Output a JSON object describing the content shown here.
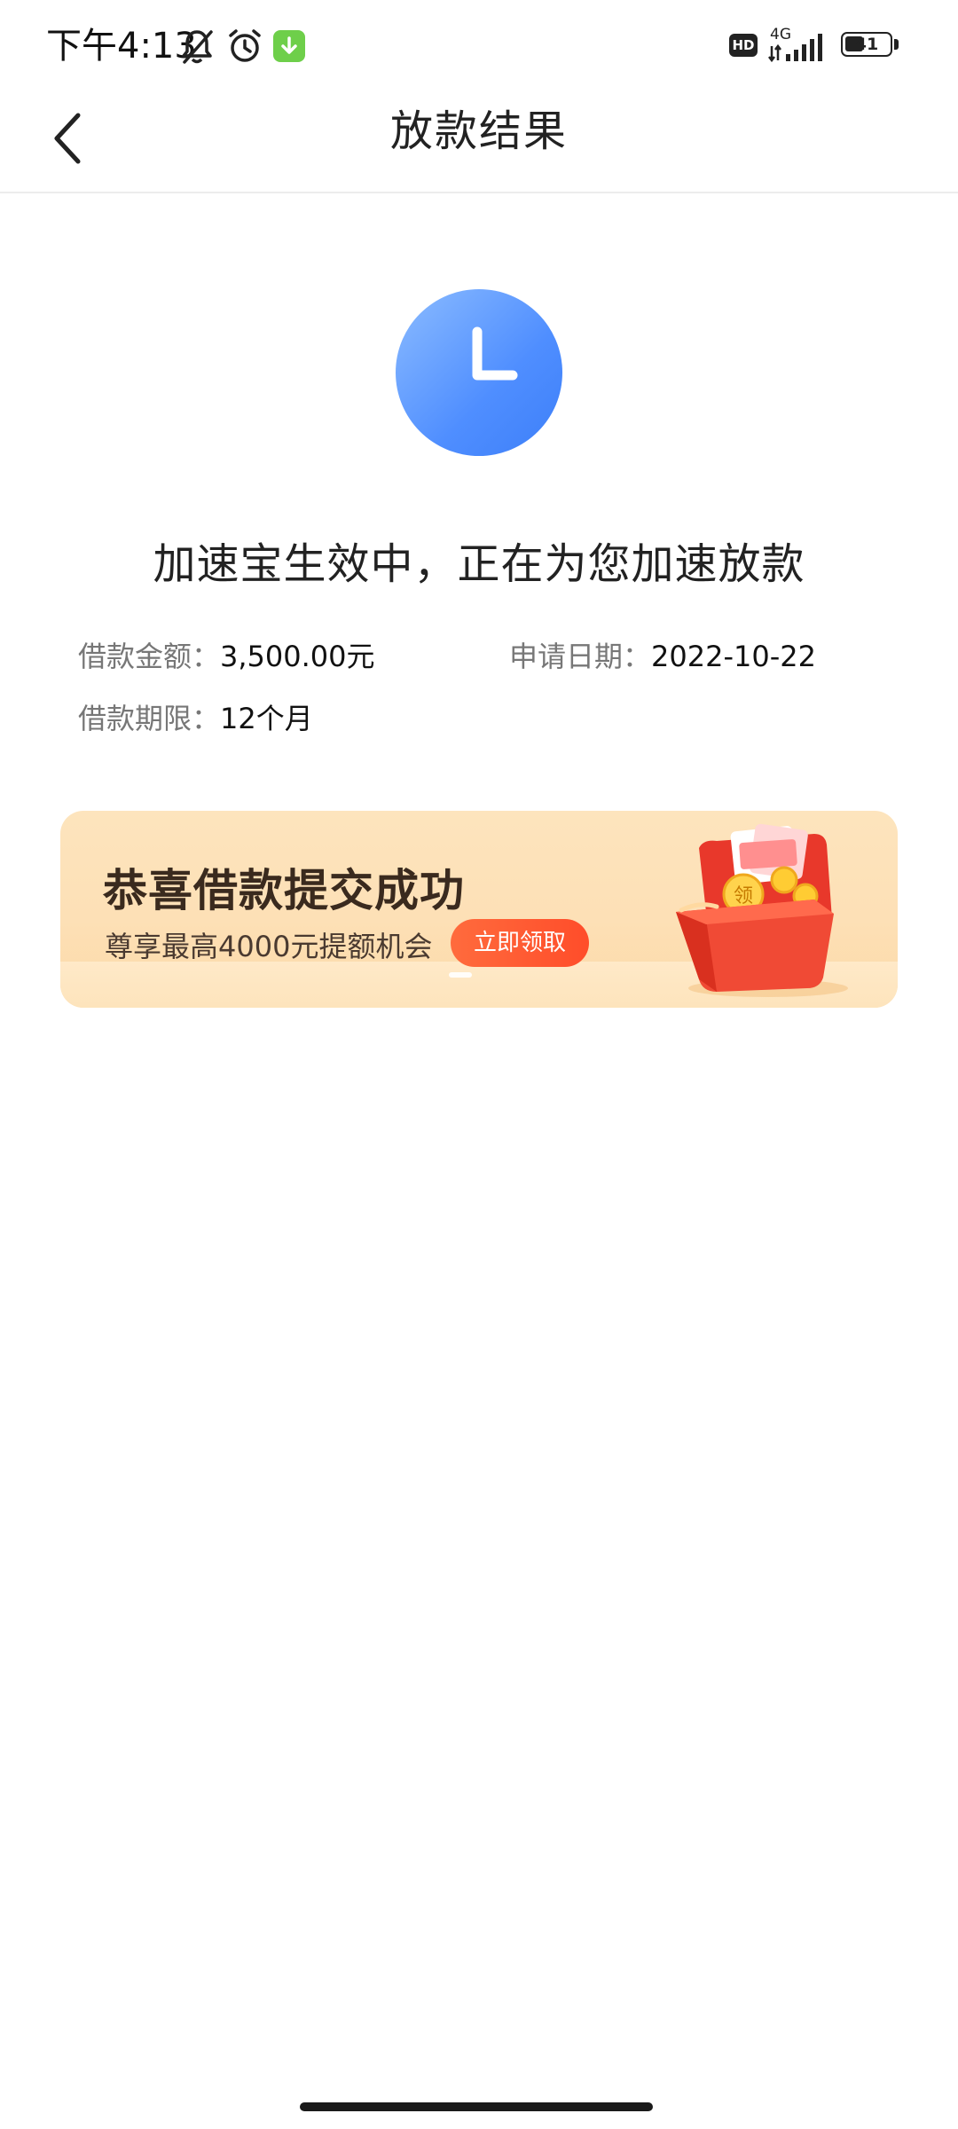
{
  "status_bar": {
    "time": "下午4:13",
    "network": "4G",
    "hd_label": "HD",
    "battery": "41",
    "icons": [
      "mute-bell-icon",
      "alarm-icon",
      "download-app-icon",
      "hd-icon",
      "signal-icon",
      "battery-icon"
    ]
  },
  "header": {
    "title": "放款结果",
    "back_icon": "chevron-left-icon"
  },
  "result": {
    "icon": "clock-icon",
    "icon_color": "#4f8eff",
    "message": "加速宝生效中，正在为您加速放款"
  },
  "loan_info": {
    "amount_label": "借款金额：",
    "amount_value": "3,500.00元",
    "date_label": "申请日期：",
    "date_value": "2022-10-22",
    "term_label": "借款期限：",
    "term_value": "12个月"
  },
  "banner": {
    "title": "恭喜借款提交成功",
    "subtitle": "尊享最高4000元提额机会",
    "cta": "立即领取",
    "cta_color": "#ff5a30",
    "gift_coin_label": "领",
    "gift_icon": "red-envelope-gift-icon"
  }
}
